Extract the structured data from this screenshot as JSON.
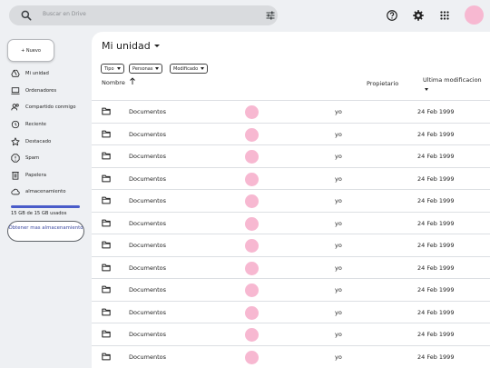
{
  "search": {
    "placeholder": "Buscar en Drive"
  },
  "topbar": {
    "icons": [
      "help-icon",
      "settings-icon",
      "apps-grid-icon"
    ],
    "avatar_color": "#f7b8d1"
  },
  "sidebar": {
    "new_label": "+ Nuevo",
    "items": [
      {
        "label": "Mi unidad",
        "icon": "my-drive-icon"
      },
      {
        "label": "Ordenadores",
        "icon": "computers-icon"
      },
      {
        "label": "Compartido conmigo",
        "icon": "shared-icon"
      },
      {
        "label": "Reciente",
        "icon": "clock-icon"
      },
      {
        "label": "Destacado",
        "icon": "star-icon"
      },
      {
        "label": "Spam",
        "icon": "spam-icon"
      },
      {
        "label": "Papelera",
        "icon": "trash-icon"
      },
      {
        "label": "almacenamiento",
        "icon": "cloud-icon"
      }
    ],
    "storage_text": "15 GB de 15 GB usados",
    "storage_fraction": 1.0,
    "more_storage_label": "Obtener mas almacenamiento"
  },
  "main": {
    "title": "Mi unidad",
    "filters": [
      "Tipo",
      "Personas",
      "Modificado"
    ],
    "columns": {
      "name": "Nombre",
      "owner": "Propietario",
      "modified": "Ultima modificacion"
    },
    "rows": [
      {
        "name": "Documentos",
        "owner": "yo",
        "modified": "24 Feb 1999"
      },
      {
        "name": "Documentos",
        "owner": "yo",
        "modified": "24 Feb 1999"
      },
      {
        "name": "Documentos",
        "owner": "yo",
        "modified": "24 Feb 1999"
      },
      {
        "name": "Documentos",
        "owner": "yo",
        "modified": "24 Feb 1999"
      },
      {
        "name": "Documentos",
        "owner": "yo",
        "modified": "24 Feb 1999"
      },
      {
        "name": "Documentos",
        "owner": "yo",
        "modified": "24 Feb 1999"
      },
      {
        "name": "Documentos",
        "owner": "yo",
        "modified": "24 Feb 1999"
      },
      {
        "name": "Documentos",
        "owner": "yo",
        "modified": "24 Feb 1999"
      },
      {
        "name": "Documentos",
        "owner": "yo",
        "modified": "24 Feb 1999"
      },
      {
        "name": "Documentos",
        "owner": "yo",
        "modified": "24 Feb 1999"
      },
      {
        "name": "Documentos",
        "owner": "yo",
        "modified": "24 Feb 1999"
      },
      {
        "name": "Documentos",
        "owner": "yo",
        "modified": "24 Feb 1999"
      }
    ]
  },
  "colors": {
    "accent": "#4a5cc9",
    "avatar": "#f7b8d1",
    "background": "#eef0f3"
  }
}
